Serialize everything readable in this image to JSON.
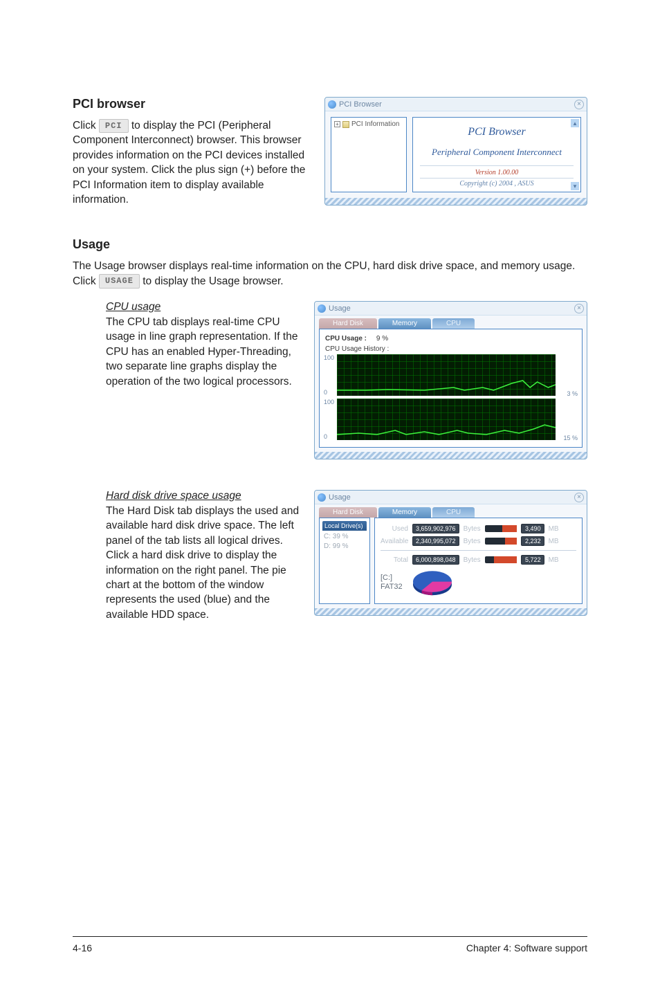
{
  "sections": {
    "pci": {
      "title": "PCI browser",
      "click_prefix": "Click ",
      "click_suffix": " to display the PCI (Peripheral Component Interconnect) browser. This browser provides information on the PCI devices installed on your system. Click the plus sign (+) before the PCI Information item to display available information.",
      "button": "PCI"
    },
    "usage": {
      "title": "Usage",
      "intro_prefix": "The Usage browser displays real-time information on the CPU, hard disk drive space, and memory usage. Click ",
      "intro_suffix": " to display the Usage browser.",
      "button": "USAGE",
      "cpu_heading": "CPU usage",
      "cpu_text": "The CPU tab displays real-time CPU usage in line graph representation. If the CPU has an enabled Hyper-Threading, two separate line graphs display the operation of the two logical processors.",
      "hdd_heading": "Hard disk drive space usage",
      "hdd_text": "The Hard Disk tab displays the used and available hard disk drive space. The left panel of the tab lists all logical drives. Click a hard disk drive to display the information on the right panel. The pie chart at the bottom of the window represents the used (blue) and the available HDD space."
    }
  },
  "pci_window": {
    "title": "PCI Browser",
    "tree_item": "PCI Information",
    "heading": "PCI Browser",
    "subheading": "Peripheral Component Interconnect",
    "version": "Version 1.00.00",
    "copyright": "Copyright (c) 2004 , ASUS"
  },
  "cpu_window": {
    "title": "Usage",
    "tabs": {
      "hd": "Hard Disk",
      "mem": "Memory",
      "cpu": "CPU"
    },
    "usage_label": "CPU Usage :",
    "usage_value": "9  %",
    "history_label": "CPU Usage History :",
    "scale_top": "100",
    "scale_bottom": "0",
    "pct1": "3 %",
    "pct2": "15 %"
  },
  "hd_window": {
    "title": "Usage",
    "tabs": {
      "hd": "Hard Disk",
      "mem": "Memory",
      "cpu": "CPU"
    },
    "drives_header": "Local Drive(s)",
    "drive_c": "C: 39 %",
    "drive_d": "D: 99 %",
    "used_label": "Used",
    "used_bytes": "3,659,902,976",
    "used_mb": "3,490",
    "avail_label": "Available",
    "avail_bytes": "2,340,995,072",
    "avail_mb": "2,232",
    "total_label": "Total",
    "total_bytes": "6,000,898,048",
    "total_mb": "5,722",
    "bytes_unit": "Bytes",
    "mb_unit": "MB",
    "pie_drive": "[C:]",
    "pie_fs": "FAT32"
  },
  "chart_data": {
    "type": "pie",
    "title": "[C:] FAT32",
    "series": [
      {
        "name": "Used",
        "value": 3490,
        "unit": "MB",
        "color": "#2f5fbf"
      },
      {
        "name": "Available",
        "value": 2232,
        "unit": "MB",
        "color": "#e23aa3"
      }
    ]
  },
  "footer": {
    "left": "4-16",
    "right": "Chapter 4: Software support"
  }
}
